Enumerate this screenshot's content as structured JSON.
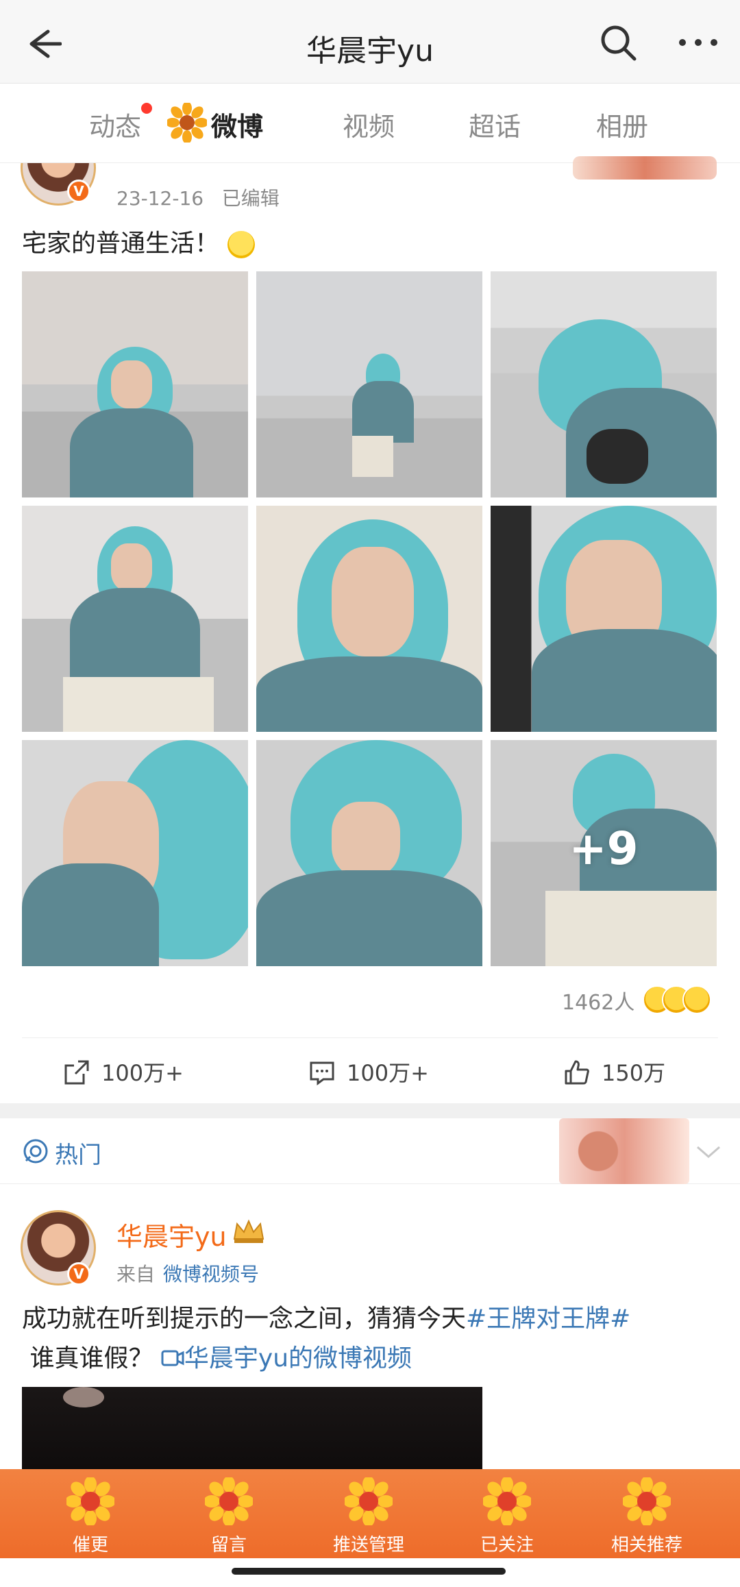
{
  "topbar": {
    "title": "华晨宇yu"
  },
  "tabs": [
    {
      "label": "动态",
      "has_dot": true
    },
    {
      "label": "微博",
      "active": true
    },
    {
      "label": "视频"
    },
    {
      "label": "超话"
    },
    {
      "label": "相册"
    }
  ],
  "post1": {
    "meta": "23-12-16   已编辑",
    "text": "宅家的普通生活！",
    "more_photos": "+9",
    "reaction_count": "1462人",
    "actions": {
      "repost": "100万+",
      "comment": "100万+",
      "like": "150万"
    }
  },
  "hot": {
    "label": "热门"
  },
  "post2": {
    "author": "华晨宇yu",
    "source_prefix": "来自",
    "source_link": "微博视频号",
    "text_part1": "成功就在听到提示的一念之间，猜猜今天",
    "hashtag": "#王牌对王牌#",
    "text_part2": " 谁真谁假？ ",
    "video_link": "华晨宇yu的微博视频"
  },
  "bottomnav": [
    {
      "label": "催更"
    },
    {
      "label": "留言"
    },
    {
      "label": "推送管理"
    },
    {
      "label": "已关注"
    },
    {
      "label": "相关推荐"
    }
  ],
  "colors": {
    "accent": "#f36a18",
    "link": "#3b78b5",
    "hair": "#62c2c9",
    "nav_bg": "#ee6c2a"
  }
}
